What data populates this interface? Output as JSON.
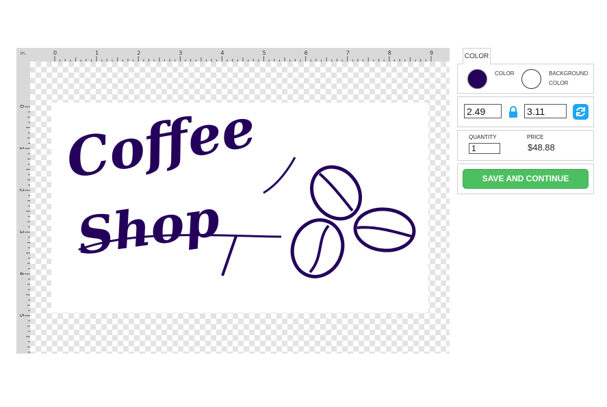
{
  "ruler": {
    "unit": "in.",
    "top_labels": [
      "0",
      "1",
      "2",
      "3",
      "4",
      "5",
      "6",
      "7",
      "8",
      "9"
    ],
    "left_labels": [
      "0",
      "1",
      "2",
      "3",
      "4",
      "5"
    ]
  },
  "artwork": {
    "line1": "Coffee",
    "line2": "Shop",
    "ink_color": "#24005b",
    "icon": "coffee-beans"
  },
  "panel": {
    "tab_label": "COLOR",
    "color_label": "COLOR",
    "bg_color_label": "BACKGROUND COLOR",
    "selected_color": "#24005b",
    "background_color": "#ffffff",
    "width": "2.49",
    "height": "3.11",
    "quantity_label": "QUANTITY",
    "quantity": "1",
    "price_label": "PRICE",
    "price": "$48.88",
    "save_label": "SAVE AND CONTINUE",
    "accent": "#4cbf60",
    "swap_color": "#1ea7f0"
  }
}
